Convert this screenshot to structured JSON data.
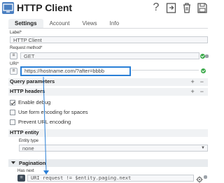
{
  "header": {
    "title": "HTTP Client",
    "help": "?"
  },
  "tabs": [
    "Settings",
    "Account",
    "Views",
    "Info"
  ],
  "form": {
    "label_label": "Label*",
    "label_value": "HTTP Client",
    "method_label": "Request method*",
    "method_value": "GET",
    "uri_label": "URI*",
    "uri_value": "https://hostname.com/?after=bbbb",
    "expr_symbol": "="
  },
  "sections": {
    "query_params": "Query parameters",
    "http_headers": "HTTP headers",
    "http_entity": "HTTP entity",
    "pagination": "Pagination",
    "plus": "+",
    "minus": "−"
  },
  "options": {
    "enable_debug": "Enable debug",
    "form_encoding": "Use form encoding for spaces",
    "prevent_url_encoding": "Prevent URL encoding"
  },
  "entity": {
    "type_label": "Entity type",
    "type_value": "none"
  },
  "pagination": {
    "has_next_label": "Has next",
    "has_next_value": "URI request != $entity.paging.next"
  }
}
